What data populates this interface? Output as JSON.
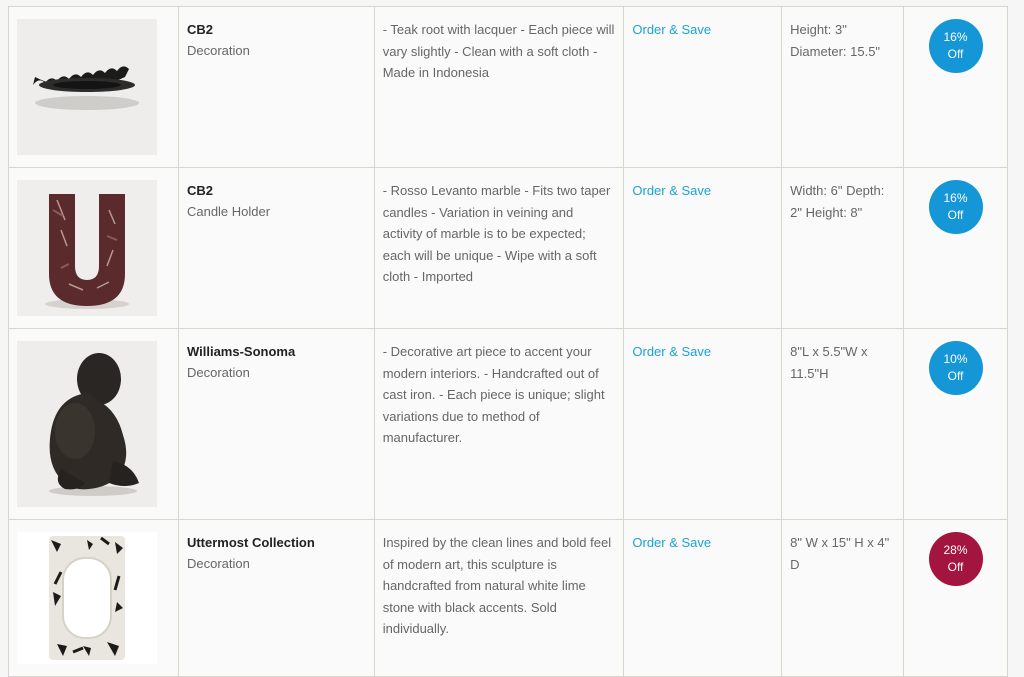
{
  "rows": [
    {
      "brand": "CB2",
      "category": "Decoration",
      "description": "- Teak root with lacquer - Each piece will vary slightly - Clean with a soft cloth - Made in Indonesia",
      "link": "Order & Save",
      "dimensions": "Height: 3\" Diameter: 15.5\"",
      "discount_line1": "16%",
      "discount_line2": "Off",
      "badge_color": "#1596d6",
      "image_icon": "dark-wavy-bowl"
    },
    {
      "brand": "CB2",
      "category": "Candle Holder",
      "description": "- Rosso Levanto marble - Fits two taper candles - Variation in veining and activity of marble is to be expected; each will be unique - Wipe with a soft cloth - Imported",
      "link": "Order & Save",
      "dimensions": "Width: 6\" Depth: 2\" Height: 8\"",
      "discount_line1": "16%",
      "discount_line2": "Off",
      "badge_color": "#1596d6",
      "image_icon": "marble-u-candle-holder"
    },
    {
      "brand": "Williams-Sonoma",
      "category": "Decoration",
      "description": "- Decorative art piece to accent your modern interiors. - Handcrafted out of cast iron. - Each piece is unique; slight variations due to method of manufacturer.",
      "link": "Order & Save",
      "dimensions": "8\"L x 5.5\"W x 11.5\"H",
      "discount_line1": "10%",
      "discount_line2": "Off",
      "badge_color": "#1596d6",
      "image_icon": "cast-iron-figure-sculpture"
    },
    {
      "brand": "Uttermost Collection",
      "category": "Decoration",
      "description": "Inspired by the clean lines and bold feel of modern art, this sculpture is handcrafted from natural white lime stone with black accents. Sold individually.",
      "link": "Order & Save",
      "dimensions": "8\" W x 15\" H x 4\" D",
      "discount_line1": "28%",
      "discount_line2": "Off",
      "badge_color": "#a3143f",
      "image_icon": "white-stone-ring-sculpture"
    }
  ]
}
